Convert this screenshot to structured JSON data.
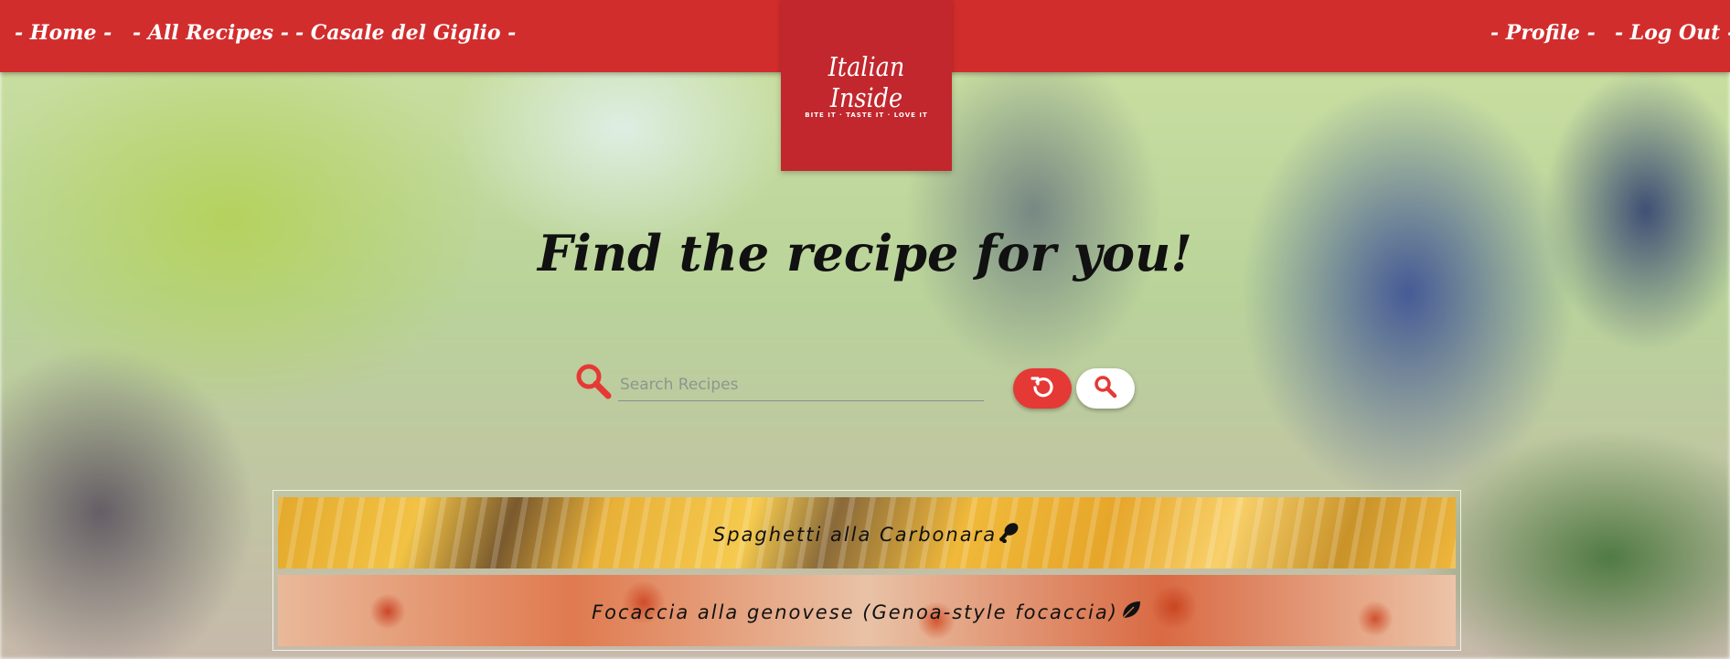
{
  "nav": {
    "home": "- Home -",
    "all_recipes": "- All Recipes -",
    "casale": "- Casale del Giglio -",
    "profile": "- Profile -",
    "logout": "- Log Out -"
  },
  "logo": {
    "title": "Italian Inside",
    "tagline": "BITE IT · TASTE IT · LOVE IT"
  },
  "hero": {
    "title": "Find the recipe for you!"
  },
  "search": {
    "placeholder": "Search Recipes",
    "value": ""
  },
  "buttons": {
    "reset_icon": "reset-icon",
    "search_icon": "search-icon"
  },
  "results": [
    {
      "title": "Spaghetti alla Carbonara",
      "icon": "meat-drumstick-icon"
    },
    {
      "title": "Focaccia alla genovese (Genoa-style focaccia)",
      "icon": "leaf-icon"
    }
  ],
  "colors": {
    "brand_red": "#d22d2d",
    "logo_red": "#c1272d",
    "accent_red": "#e53935"
  }
}
